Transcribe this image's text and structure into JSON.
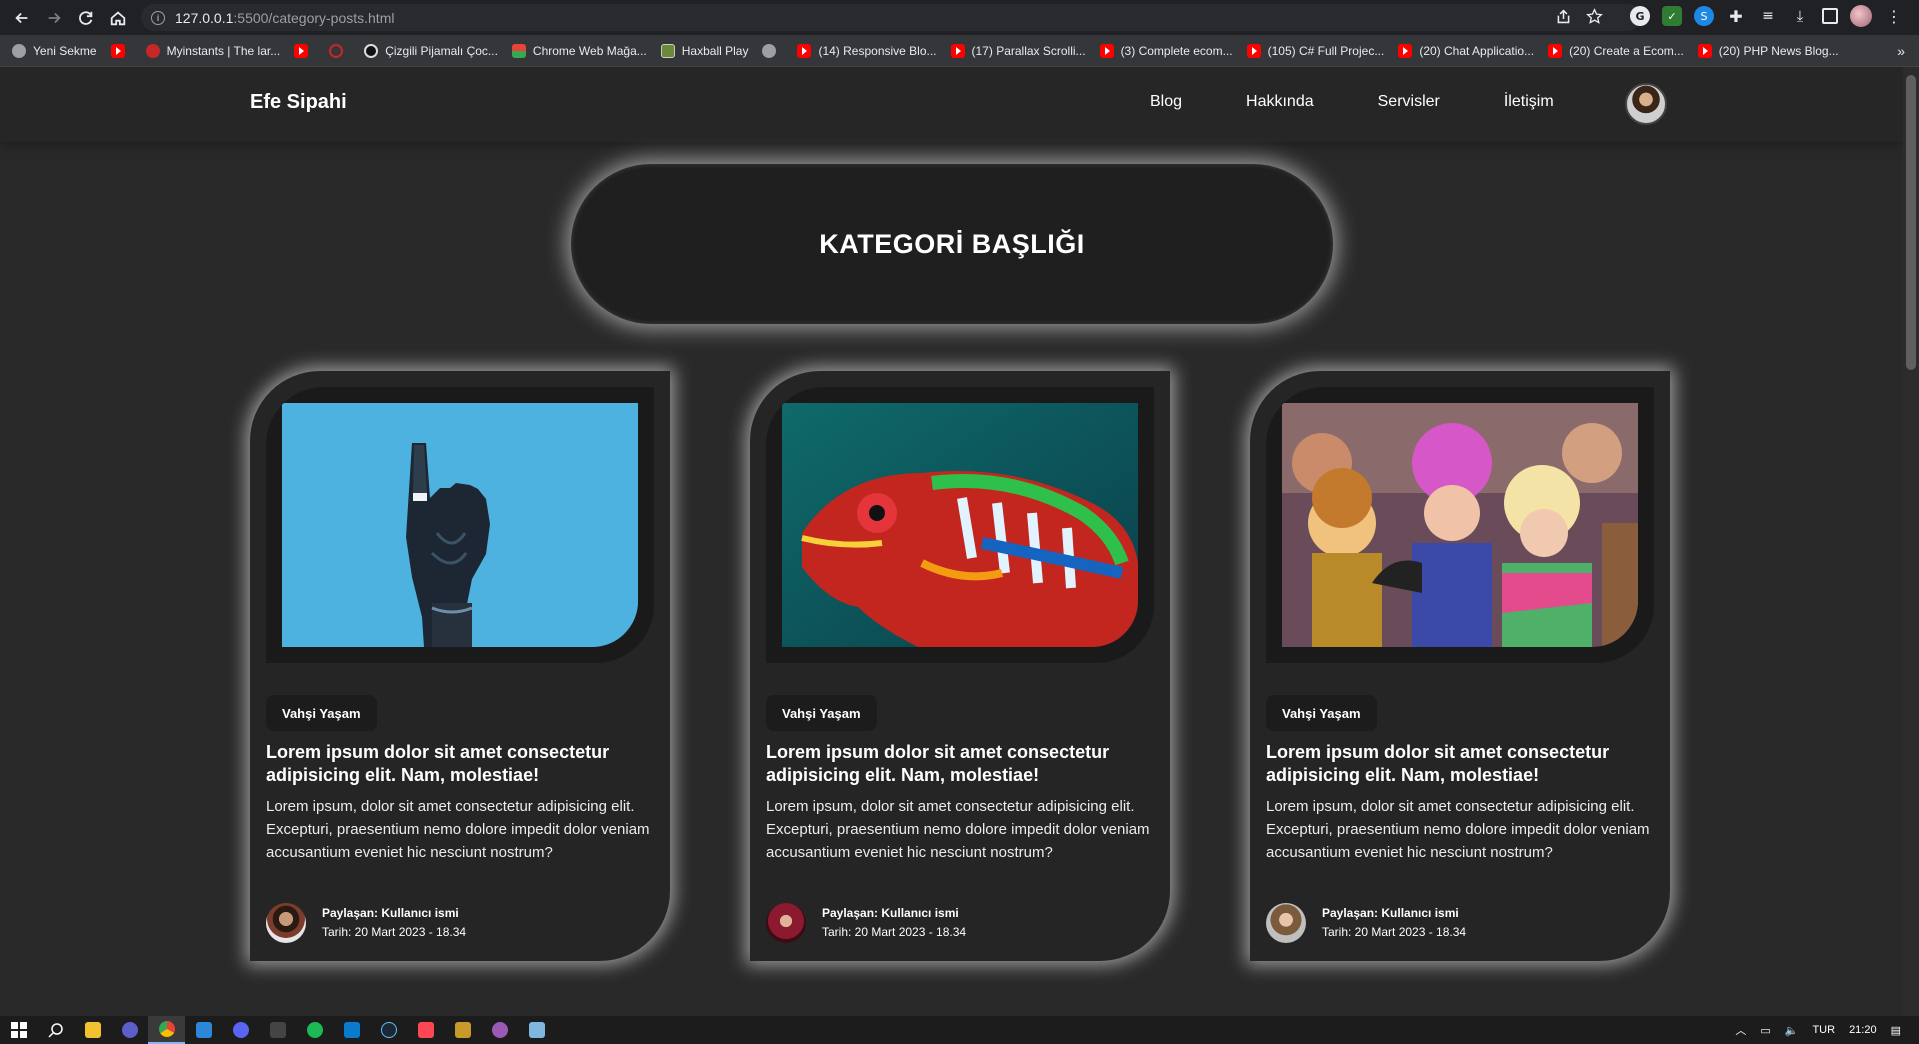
{
  "browser": {
    "url_host": "127.0.0.1",
    "url_path": ":5500/category-posts.html",
    "bookmarks": [
      {
        "label": "Yeni Sekme",
        "icon": "globe"
      },
      {
        "label": "",
        "icon": "yt"
      },
      {
        "label": "Myinstants | The lar...",
        "icon": "red-circle"
      },
      {
        "label": "",
        "icon": "yt"
      },
      {
        "label": "",
        "icon": "ring"
      },
      {
        "label": "Çizgili Pijamalı Çoc...",
        "icon": "film"
      },
      {
        "label": "Chrome Web Mağa...",
        "icon": "store"
      },
      {
        "label": "Haxball Play",
        "icon": "hax"
      },
      {
        "label": "",
        "icon": "globe"
      },
      {
        "label": "(14) Responsive Blo...",
        "icon": "yt"
      },
      {
        "label": "(17) Parallax Scrolli...",
        "icon": "yt"
      },
      {
        "label": "(3) Complete ecom...",
        "icon": "yt"
      },
      {
        "label": "(105) C# Full Projec...",
        "icon": "yt"
      },
      {
        "label": "(20) Chat Applicatio...",
        "icon": "yt"
      },
      {
        "label": "(20) Create a Ecom...",
        "icon": "yt"
      },
      {
        "label": "(20) PHP News Blog...",
        "icon": "yt"
      }
    ],
    "more": "»"
  },
  "site": {
    "brand": "Efe Sipahi",
    "nav": [
      "Blog",
      "Hakkında",
      "Servisler",
      "İletişim"
    ],
    "hero_title": "KATEGORİ BAŞLIĞI"
  },
  "cards": [
    {
      "image": "robot-hand",
      "tag": "Vahşi Yaşam",
      "title": "Lorem ipsum dolor sit amet consectetur adipisicing elit. Nam, molestiae!",
      "text": "Lorem ipsum, dolor sit amet consectetur adipisicing elit. Excepturi, praesentium nemo dolore impedit dolor veniam accusantium eveniet hic nesciunt nostrum?",
      "author": "Paylaşan: Kullanıcı ismi",
      "date": "Tarih: 20 Mart 2023 - 18.34"
    },
    {
      "image": "chameleon",
      "tag": "Vahşi Yaşam",
      "title": "Lorem ipsum dolor sit amet consectetur adipisicing elit. Nam, molestiae!",
      "text": "Lorem ipsum, dolor sit amet consectetur adipisicing elit. Excepturi, praesentium nemo dolore impedit dolor veniam accusantium eveniet hic nesciunt nostrum?",
      "author": "Paylaşan: Kullanıcı ismi",
      "date": "Tarih: 20 Mart 2023 - 18.34"
    },
    {
      "image": "parade",
      "tag": "Vahşi Yaşam",
      "title": "Lorem ipsum dolor sit amet consectetur adipisicing elit. Nam, molestiae!",
      "text": "Lorem ipsum, dolor sit amet consectetur adipisicing elit. Excepturi, praesentium nemo dolore impedit dolor veniam accusantium eveniet hic nesciunt nostrum?",
      "author": "Paylaşan: Kullanıcı ismi",
      "date": "Tarih: 20 Mart 2023 - 18.34"
    }
  ],
  "taskbar": {
    "lang": "TUR",
    "time": "21:20"
  }
}
